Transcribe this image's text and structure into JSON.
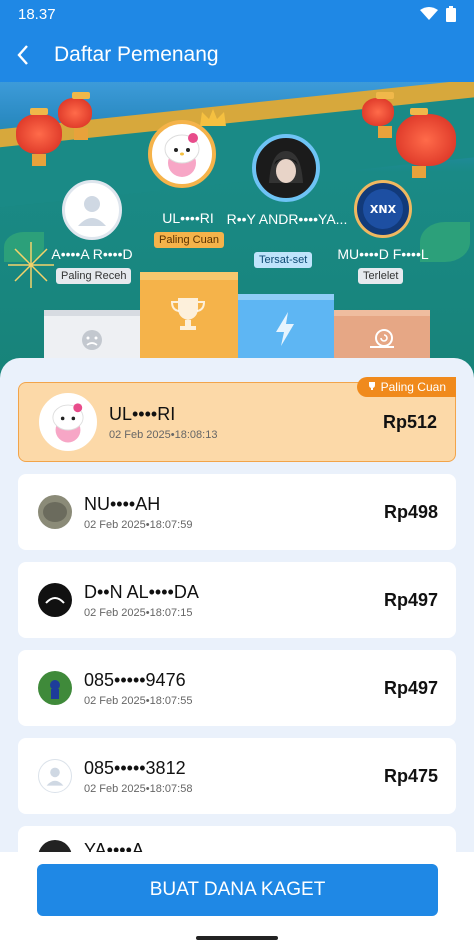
{
  "status": {
    "time": "18.37"
  },
  "header": {
    "title": "Daftar Pemenang"
  },
  "podium": {
    "first": {
      "name": "UL••••RI",
      "badge": "Paling Cuan"
    },
    "second": {
      "name": "R••Y ANDR••••YA...",
      "badge": "Tersat-set"
    },
    "third": {
      "name": "A••••A R••••D",
      "badge": "Paling Receh"
    },
    "fourth": {
      "name": "MU••••D F••••L",
      "badge": "Terlelet"
    }
  },
  "winners": [
    {
      "name": "UL••••RI",
      "date": "02 Feb 2025•18:08:13",
      "amount": "Rp512",
      "tag": "Paling Cuan"
    },
    {
      "name": "NU••••AH",
      "date": "02 Feb 2025•18:07:59",
      "amount": "Rp498"
    },
    {
      "name": "D••N AL••••DA",
      "date": "02 Feb 2025•18:07:15",
      "amount": "Rp497"
    },
    {
      "name": "085•••••9476",
      "date": "02 Feb 2025•18:07:55",
      "amount": "Rp497"
    },
    {
      "name": "085•••••3812",
      "date": "02 Feb 2025•18:07:58",
      "amount": "Rp475"
    },
    {
      "name": "YA••••A",
      "date": "",
      "amount": ""
    }
  ],
  "cta": {
    "label": "BUAT DANA KAGET"
  },
  "colors": {
    "primary": "#1f88e5",
    "gold": "#f5b34a",
    "orange": "#f08a1c",
    "teal": "#1a8a86"
  }
}
